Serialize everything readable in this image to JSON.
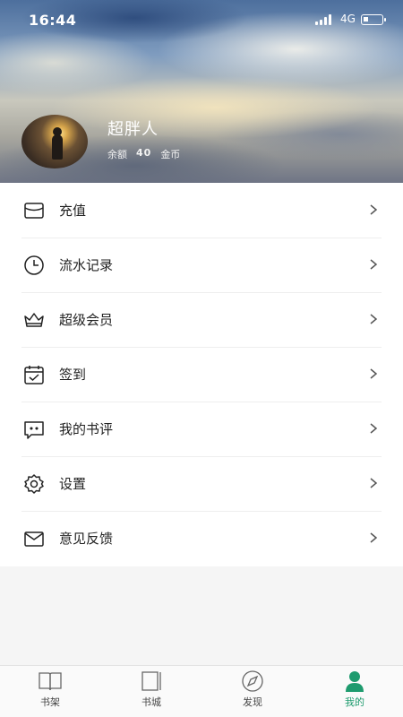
{
  "status_bar": {
    "time": "16:44",
    "network": "4G"
  },
  "profile": {
    "username": "超胖人",
    "balance_label": "余额",
    "balance_value": "40",
    "balance_unit": "金币"
  },
  "menu": {
    "items": [
      {
        "label": "充值",
        "icon": "wallet-icon"
      },
      {
        "label": "流水记录",
        "icon": "clock-icon"
      },
      {
        "label": "超级会员",
        "icon": "crown-icon"
      },
      {
        "label": "签到",
        "icon": "calendar-check-icon"
      },
      {
        "label": "我的书评",
        "icon": "comment-icon"
      },
      {
        "label": "设置",
        "icon": "gear-icon"
      },
      {
        "label": "意见反馈",
        "icon": "mail-icon"
      }
    ]
  },
  "tabbar": {
    "tabs": [
      {
        "label": "书架",
        "icon": "open-book-icon"
      },
      {
        "label": "书城",
        "icon": "bookshelf-icon"
      },
      {
        "label": "发现",
        "icon": "compass-icon"
      },
      {
        "label": "我的",
        "icon": "person-icon",
        "active": true
      }
    ]
  },
  "colors": {
    "accent": "#1e9b6e",
    "divider": "#eeeeee",
    "background": "#f5f5f5"
  }
}
